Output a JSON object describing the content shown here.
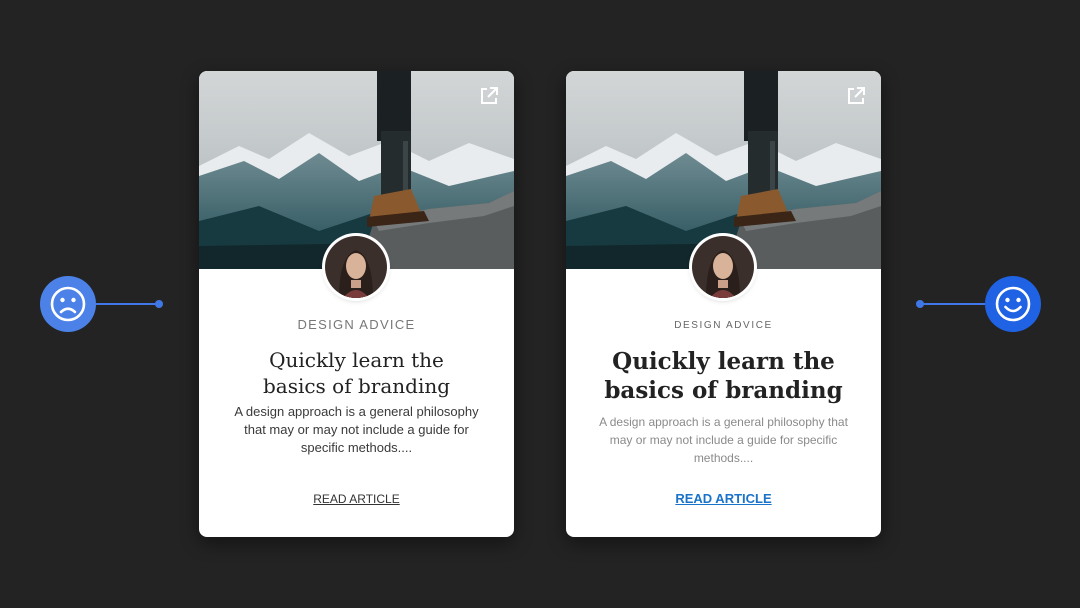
{
  "colors": {
    "background": "#232323",
    "sad_face": "#4c82e8",
    "happy_face": "#1f62e4",
    "cta_link": "#1a73c9"
  },
  "indicators": {
    "left": {
      "icon": "sad-face-icon",
      "meaning": "bad example"
    },
    "right": {
      "icon": "happy-face-icon",
      "meaning": "good example"
    }
  },
  "cards": [
    {
      "variant": "bad",
      "category": "DESIGN ADVICE",
      "title_line1": "Quickly learn the",
      "title_line2": "basics of branding",
      "description": "A design approach is a general philosophy that may or may not include a guide for specific methods....",
      "cta": "READ ARTICLE",
      "icon": "external-link-icon"
    },
    {
      "variant": "good",
      "category": "DESIGN ADVICE",
      "title_line1": "Quickly learn the",
      "title_line2": "basics of branding",
      "description": "A design approach is a general philosophy that may or may not include a guide for specific methods....",
      "cta": "READ ARTICLE",
      "icon": "external-link-icon"
    }
  ]
}
